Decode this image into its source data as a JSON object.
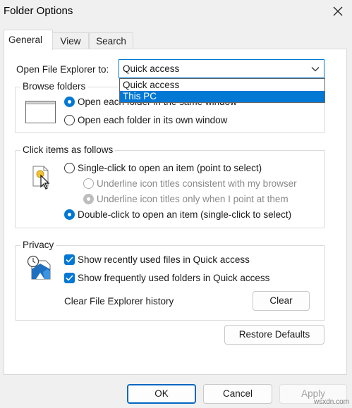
{
  "window": {
    "title": "Folder Options"
  },
  "tabs": [
    {
      "label": "General"
    },
    {
      "label": "View"
    },
    {
      "label": "Search"
    }
  ],
  "open_explorer": {
    "label": "Open File Explorer to:",
    "selected": "Quick access",
    "options": [
      "Quick access",
      "This PC"
    ],
    "highlighted": "This PC"
  },
  "browse_folders": {
    "title": "Browse folders",
    "option1": "Open each folder in the same window",
    "option2": "Open each folder in its own window",
    "selected": "option1"
  },
  "click_items": {
    "title": "Click items as follows",
    "single_click": "Single-click to open an item (point to select)",
    "underline_browser": "Underline icon titles consistent with my browser",
    "underline_point": "Underline icon titles only when I point at them",
    "double_click": "Double-click to open an item (single-click to select)",
    "selected": "double_click"
  },
  "privacy": {
    "title": "Privacy",
    "recent_files": "Show recently used files in Quick access",
    "frequent_folders": "Show frequently used folders in Quick access",
    "recent_files_checked": true,
    "frequent_folders_checked": true,
    "clear_label": "Clear File Explorer history",
    "clear_button": "Clear"
  },
  "restore_defaults": "Restore Defaults",
  "footer": {
    "ok": "OK",
    "cancel": "Cancel",
    "apply": "Apply"
  },
  "watermark": "wsxdn.com",
  "colors": {
    "accent": "#0078d4",
    "window_bg": "#f0f0f0",
    "panel_bg": "#ffffff"
  }
}
